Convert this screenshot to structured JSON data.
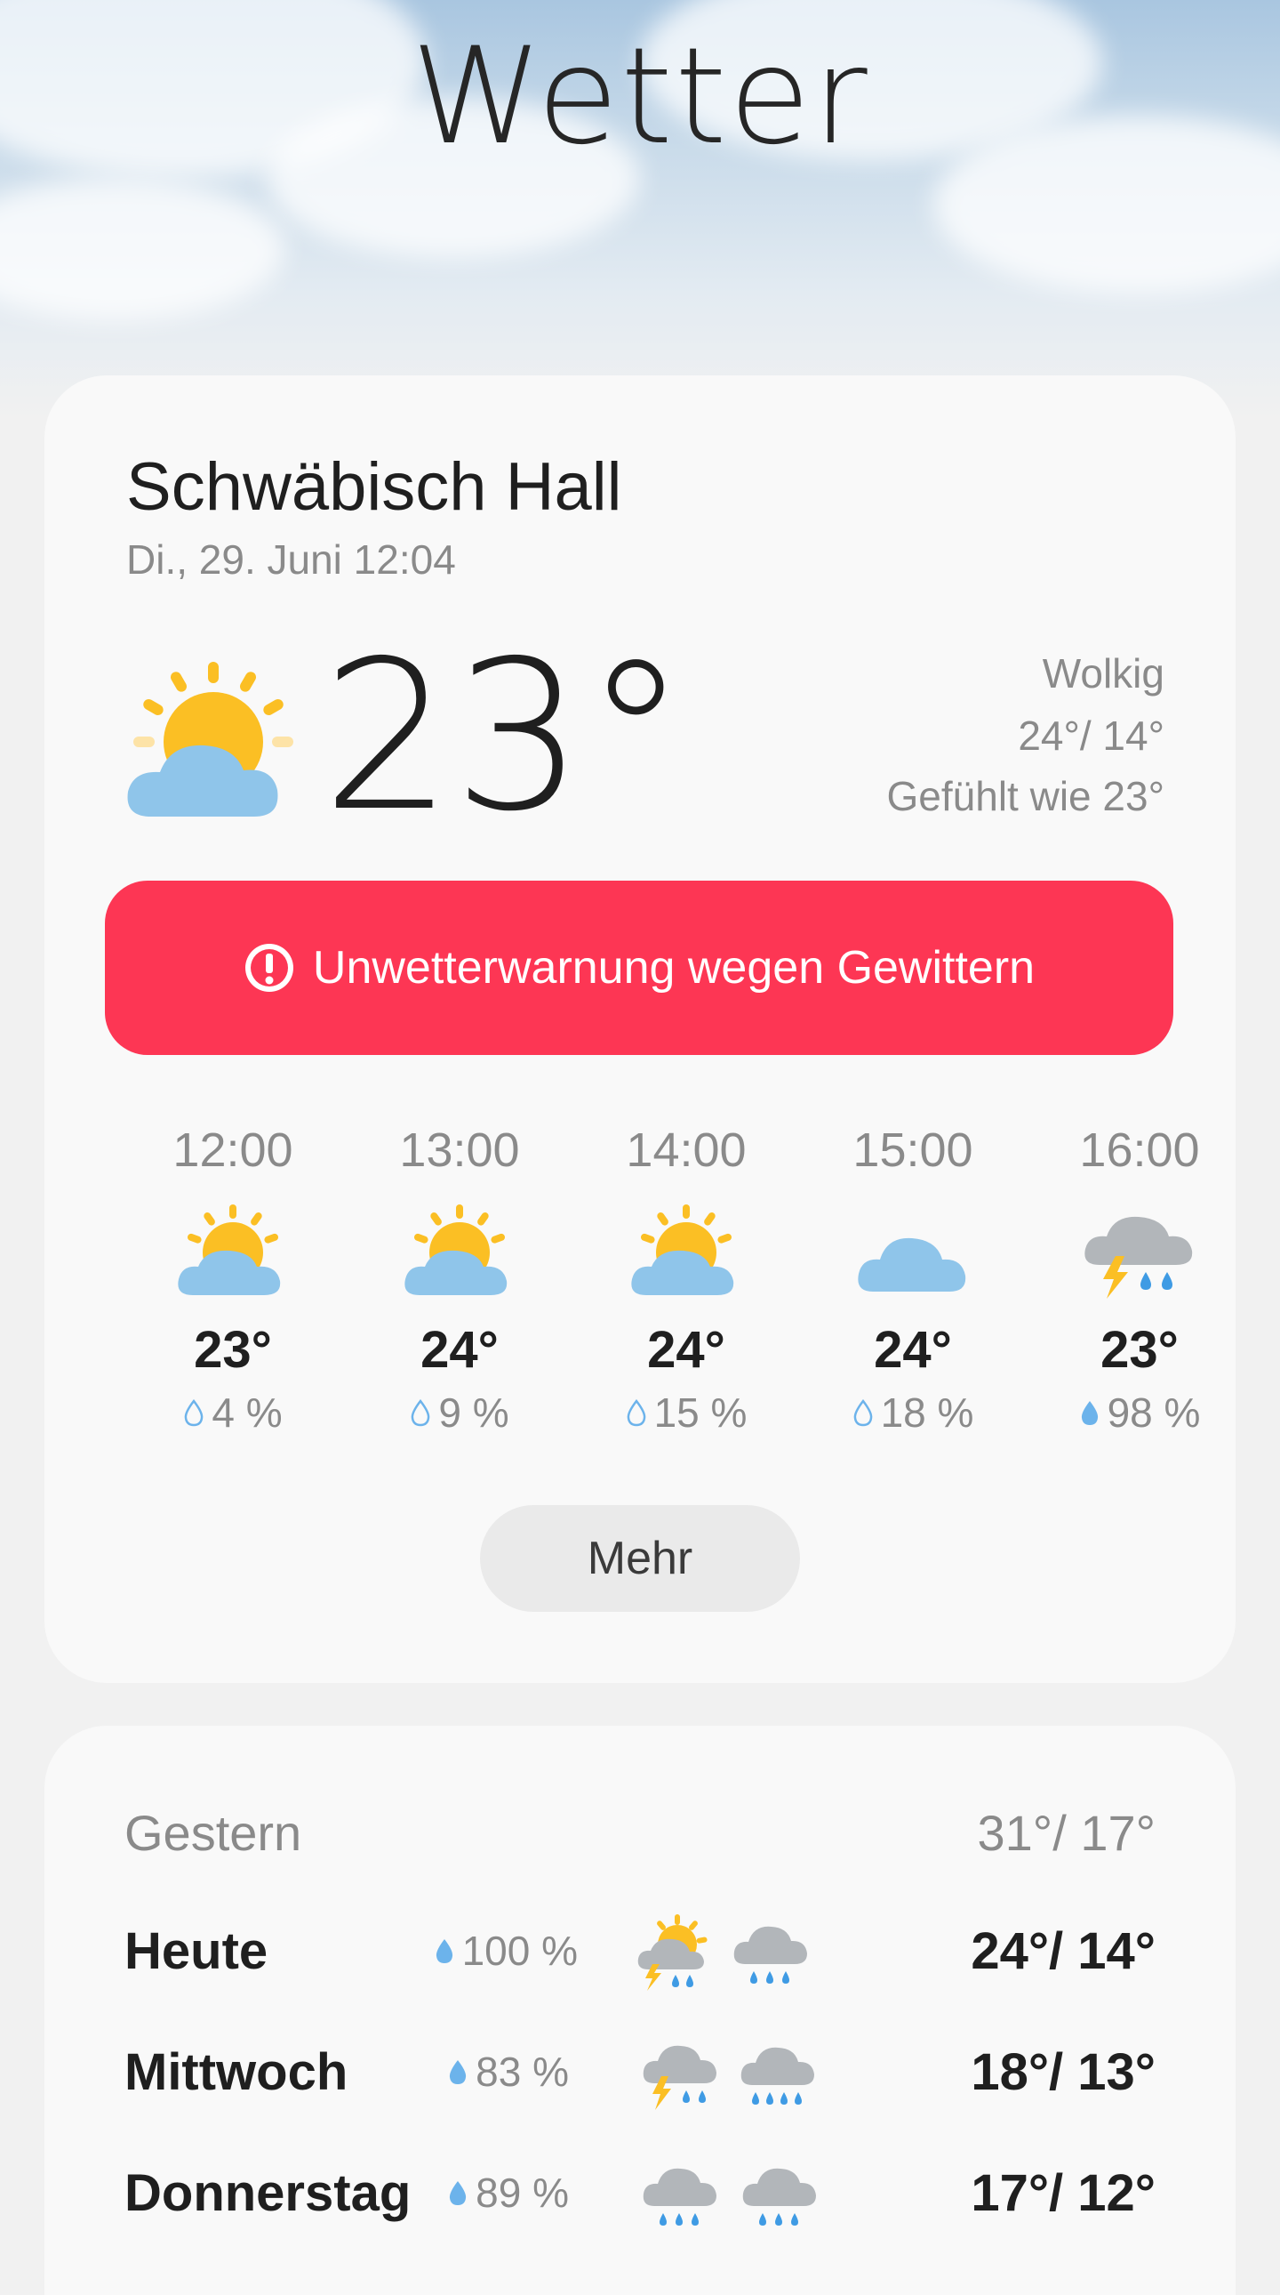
{
  "app": {
    "title": "Wetter"
  },
  "current": {
    "location": "Schwäbisch Hall",
    "datetime": "Di., 29. Juni 12:04",
    "temperature": "23°",
    "icon": "partly-cloudy-icon",
    "condition": "Wolkig",
    "range": "24°/ 14°",
    "feels_like": "Gefühlt wie 23°"
  },
  "warning": {
    "text": "Unwetterwarnung wegen Gewittern",
    "icon": "exclamation-circle-icon",
    "color": "#fd3654"
  },
  "hourly": [
    {
      "time": "12:00",
      "icon": "partly-cloudy-icon",
      "temp": "23°",
      "precip": "4 %",
      "precip_filled": false
    },
    {
      "time": "13:00",
      "icon": "partly-cloudy-icon",
      "temp": "24°",
      "precip": "9 %",
      "precip_filled": false
    },
    {
      "time": "14:00",
      "icon": "partly-cloudy-icon",
      "temp": "24°",
      "precip": "15 %",
      "precip_filled": false
    },
    {
      "time": "15:00",
      "icon": "cloud-icon",
      "temp": "24°",
      "precip": "18 %",
      "precip_filled": false
    },
    {
      "time": "16:00",
      "icon": "thunderstorm-icon",
      "temp": "23°",
      "precip": "98 %",
      "precip_filled": true
    }
  ],
  "more_button": {
    "label": "Mehr"
  },
  "daily": {
    "yesterday": {
      "label": "Gestern",
      "range": "31°/ 17°"
    },
    "days": [
      {
        "name": "Heute",
        "precip": "100 %",
        "icon_day": "sun-thunder-rain-icon",
        "icon_night": "rain-cloud-icon",
        "range": "24°/ 14°"
      },
      {
        "name": "Mittwoch",
        "precip": "83 %",
        "icon_day": "thunderstorm-icon",
        "icon_night": "heavy-rain-icon",
        "range": "18°/ 13°"
      },
      {
        "name": "Donnerstag",
        "precip": "89 %",
        "icon_day": "rain-cloud-icon",
        "icon_night": "rain-cloud-icon",
        "range": "17°/ 12°"
      }
    ]
  },
  "colors": {
    "sun": "#fbbf24",
    "cloud_blue": "#8fc5ea",
    "cloud_grey": "#b2b6ba",
    "rain_drop": "#3f9be4",
    "precip_drop": "#6cb3eb"
  }
}
